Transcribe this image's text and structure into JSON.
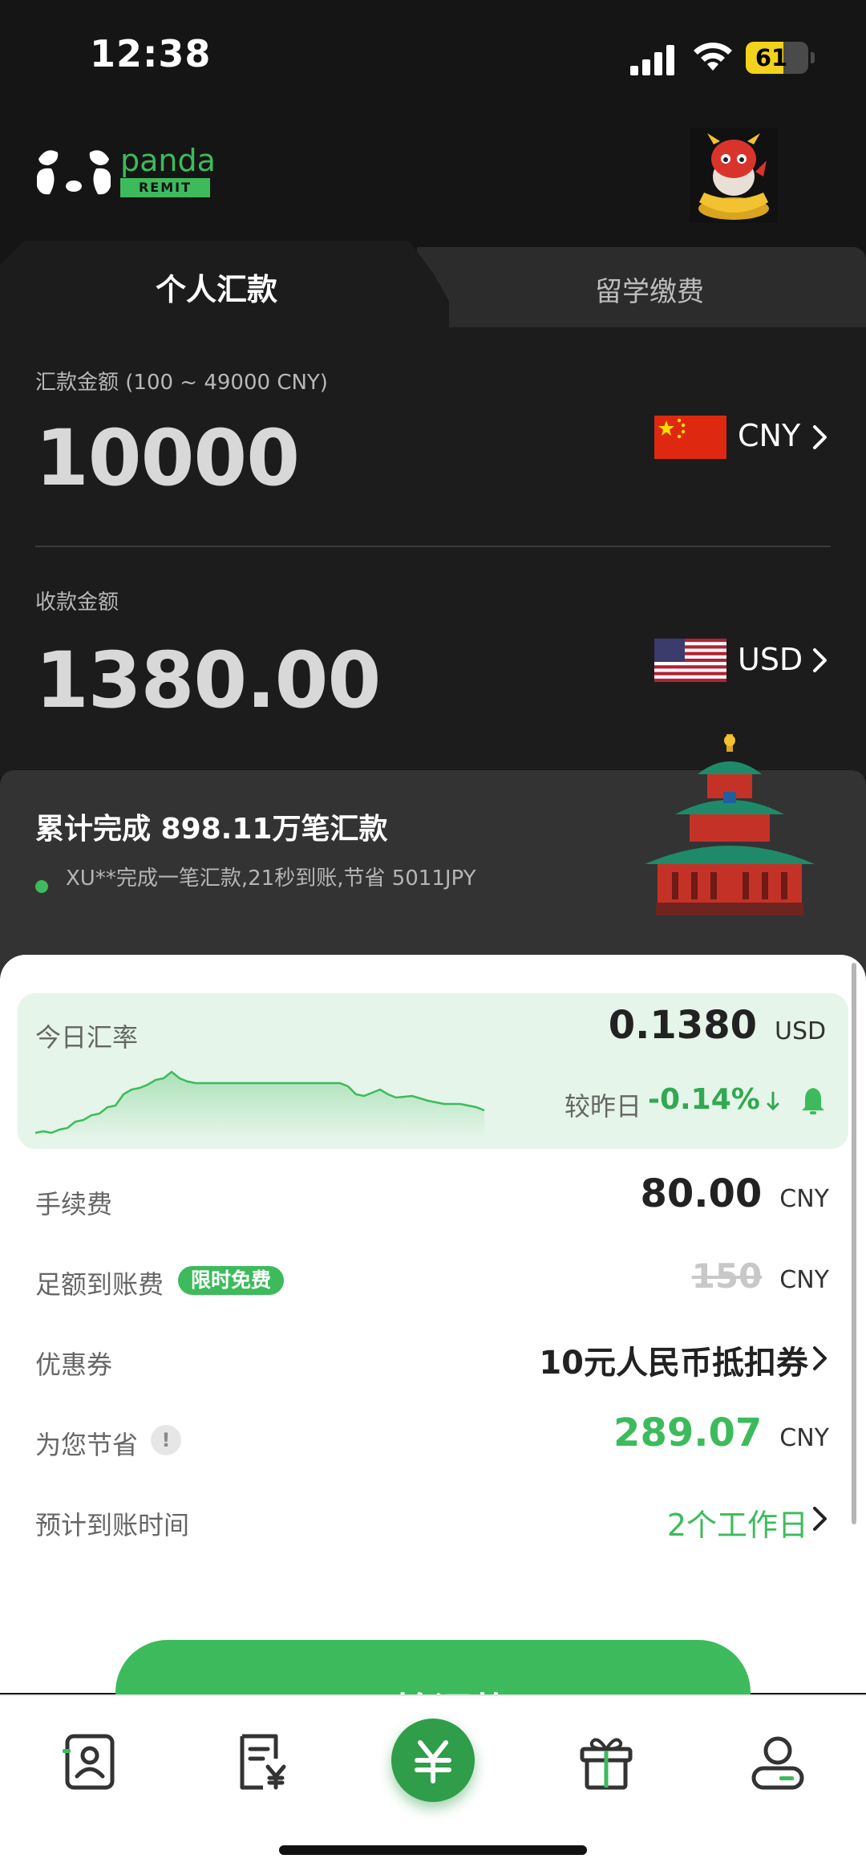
{
  "status_bar": {
    "time": "12:38",
    "battery": "61"
  },
  "brand": {
    "name": "panda",
    "tagline": "REMIT"
  },
  "tabs": [
    {
      "label": "个人汇款",
      "active": true
    },
    {
      "label": "留学缴费",
      "active": false
    }
  ],
  "send": {
    "label": "汇款金额 (100 ~ 49000 CNY)",
    "amount": "10000",
    "currency": "CNY"
  },
  "receive": {
    "label": "收款金额",
    "amount": "1380.00",
    "currency": "USD"
  },
  "stats": {
    "title": "累计完成 898.11万笔汇款",
    "ticker": "XU**完成一笔汇款,21秒到账,节省 5011JPY"
  },
  "rate": {
    "label": "今日汇率",
    "value": "0.1380",
    "unit": "USD",
    "vs_label": "较昨日",
    "vs_value": "-0.14%"
  },
  "fee": {
    "label": "手续费",
    "value": "80.00",
    "unit": "CNY"
  },
  "full_arrival": {
    "label": "足额到账费",
    "badge": "限时免费",
    "value": "150",
    "unit": "CNY"
  },
  "coupon": {
    "label": "优惠券",
    "value": "10元人民币抵扣券"
  },
  "savings": {
    "label": "为您节省",
    "info": "!",
    "value": "289.07",
    "unit": "CNY"
  },
  "eta": {
    "label": "预计到账时间",
    "value": "2个工作日"
  },
  "cta": {
    "label": "开始汇款"
  },
  "nav": [
    {
      "icon": "contacts-icon"
    },
    {
      "icon": "orders-icon"
    },
    {
      "icon": "remit-icon",
      "active": true
    },
    {
      "icon": "gift-icon"
    },
    {
      "icon": "profile-icon"
    }
  ],
  "colors": {
    "brand_green": "#3dbb5c",
    "dark_bg": "#151515",
    "rate_card_bg": "#e5f5e9"
  }
}
